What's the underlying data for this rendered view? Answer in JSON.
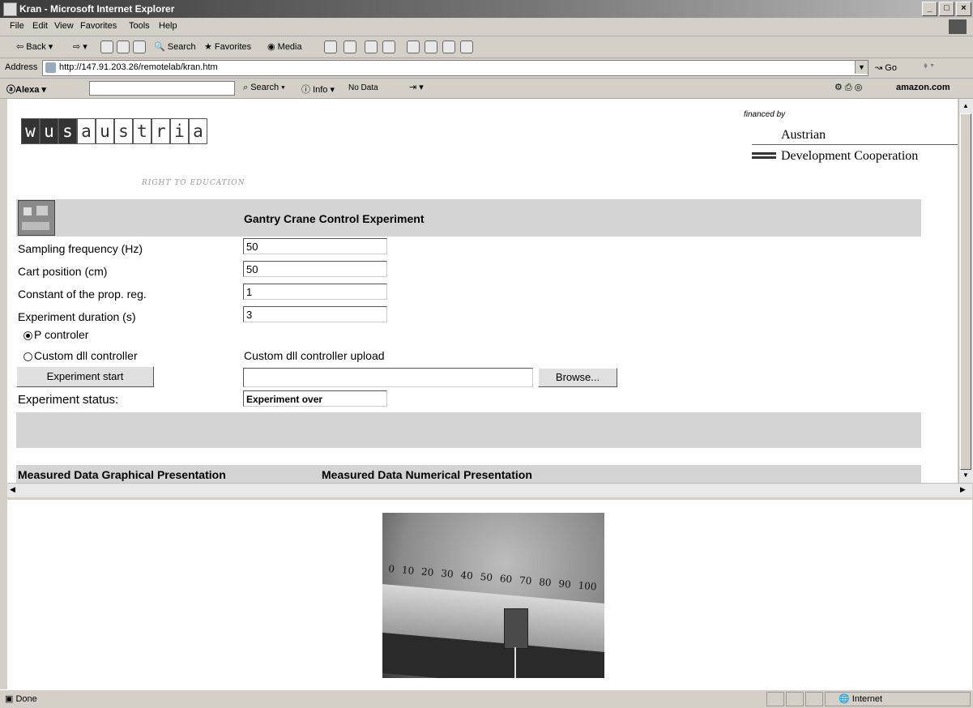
{
  "window": {
    "title": "Kran - Microsoft Internet Explorer",
    "min": "_",
    "max": "□",
    "close": "×"
  },
  "menu": [
    "File",
    "Edit",
    "View",
    "Favorites",
    "Tools",
    "Help"
  ],
  "toolbar": {
    "back": "Back",
    "search": "Search",
    "favorites": "Favorites",
    "media": "Media"
  },
  "address": {
    "label": "Address",
    "url": "http://147.91.203.26/remotelab/kran.htm",
    "go": "Go"
  },
  "alexa": {
    "label": "Alexa",
    "search": "Search",
    "info": "Info",
    "nodata": "No Data",
    "amazon": "amazon.com"
  },
  "header": {
    "logo_letters": [
      "w",
      "u",
      "s",
      "a",
      "u",
      "s",
      "t",
      "r",
      "i",
      "a"
    ],
    "tagline": "RIGHT TO EDUCATION",
    "financed_by": "financed by",
    "org_line1": "Austrian",
    "org_line2": "Development Cooperation"
  },
  "form": {
    "title": "Gantry Crane Control Experiment",
    "fields": [
      {
        "label": "Sampling frequency (Hz)",
        "value": "50"
      },
      {
        "label": "Cart position (cm)",
        "value": "50"
      },
      {
        "label": "Constant of the prop. reg.",
        "value": "1"
      },
      {
        "label": "Experiment duration (s)",
        "value": "3"
      }
    ],
    "radio_p": "P controler",
    "radio_custom": "Custom dll controller",
    "upload_label": "Custom dll controller upload",
    "start_button": "Experiment start",
    "browse_button": "Browse...",
    "status_label": "Experiment status:",
    "status_value": "Experiment over",
    "graphical": "Measured Data Graphical Presentation",
    "numerical": "Measured Data Numerical Presentation"
  },
  "camera": {
    "scale_labels": [
      "0",
      "10",
      "20",
      "30",
      "40",
      "50",
      "60",
      "70",
      "80",
      "90",
      "100"
    ]
  },
  "statusbar": {
    "text": "Done",
    "zone": "Internet"
  }
}
